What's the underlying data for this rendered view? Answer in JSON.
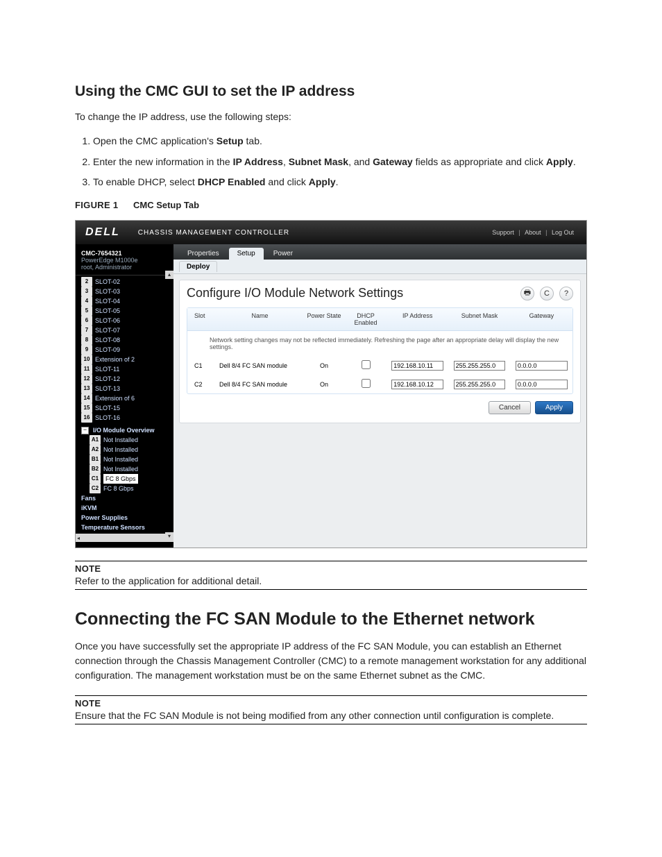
{
  "doc": {
    "h1": "Using the CMC GUI to set the IP address",
    "intro": "To change the IP address, use the following steps:",
    "steps": [
      {
        "pre": "Open the CMC application's ",
        "b": "Setup",
        "post": " tab."
      },
      {
        "pre": "Enter the new information in the ",
        "b": "IP Address",
        "mid": ", ",
        "b2": "Subnet Mask",
        "mid2": ", and ",
        "b3": "Gateway",
        "post": " fields as appropriate and click ",
        "b4": "Apply",
        "end": "."
      },
      {
        "pre": "To enable DHCP, select ",
        "b": "DHCP Enabled",
        "mid": " and click ",
        "b2": "Apply",
        "post": "."
      }
    ],
    "fig_label": "FIGURE 1",
    "fig_title": "CMC Setup Tab",
    "note1_word": "NOTE",
    "note1_text": "Refer to the application for additional detail.",
    "h2": "Connecting the FC SAN Module to the Ethernet network",
    "para2": "Once you have successfully set the appropriate IP address of the FC SAN Module, you can establish an Ethernet connection through the Chassis Management Controller (CMC) to a remote management workstation for any additional configuration. The management workstation must be on the same Ethernet subnet as the CMC.",
    "note2_word": "NOTE",
    "note2_text": "Ensure that the FC SAN Module is not being modified from any other connection until configuration is complete."
  },
  "cmc": {
    "logo": "DELL",
    "title": "CHASSIS MANAGEMENT CONTROLLER",
    "hdr_links": {
      "support": "Support",
      "about": "About",
      "logout": "Log Out"
    },
    "chassis": "CMC-7654321",
    "model": "PowerEdge M1000e",
    "user": "root, Administrator",
    "slots": [
      {
        "n": "2",
        "t": "SLOT-02"
      },
      {
        "n": "3",
        "t": "SLOT-03"
      },
      {
        "n": "4",
        "t": "SLOT-04"
      },
      {
        "n": "5",
        "t": "SLOT-05"
      },
      {
        "n": "6",
        "t": "SLOT-06"
      },
      {
        "n": "7",
        "t": "SLOT-07"
      },
      {
        "n": "8",
        "t": "SLOT-08"
      },
      {
        "n": "9",
        "t": "SLOT-09"
      },
      {
        "n": "10",
        "t": "Extension of 2"
      },
      {
        "n": "11",
        "t": "SLOT-11"
      },
      {
        "n": "12",
        "t": "SLOT-12"
      },
      {
        "n": "13",
        "t": "SLOT-13"
      },
      {
        "n": "14",
        "t": "Extension of 6"
      },
      {
        "n": "15",
        "t": "SLOT-15"
      },
      {
        "n": "16",
        "t": "SLOT-16"
      }
    ],
    "io_overview": "I/O Module Overview",
    "io_items": [
      {
        "n": "A1",
        "t": "Not Installed"
      },
      {
        "n": "A2",
        "t": "Not Installed"
      },
      {
        "n": "B1",
        "t": "Not Installed"
      },
      {
        "n": "B2",
        "t": "Not Installed"
      },
      {
        "n": "C1",
        "t": "FC 8 Gbps",
        "sel": true
      },
      {
        "n": "C2",
        "t": "FC 8 Gbps"
      }
    ],
    "extras": [
      "Fans",
      "iKVM",
      "Power Supplies",
      "Temperature Sensors"
    ],
    "tabs": {
      "properties": "Properties",
      "setup": "Setup",
      "power": "Power"
    },
    "subtab": "Deploy",
    "content_title": "Configure I/O Module Network Settings",
    "cols": {
      "slot": "Slot",
      "name": "Name",
      "pstate": "Power State",
      "dhcp": "DHCP Enabled",
      "ip": "IP Address",
      "mask": "Subnet Mask",
      "gw": "Gateway"
    },
    "note": "Network setting changes may not be reflected immediately. Refreshing the page after an appropriate delay will display the new settings.",
    "rows": [
      {
        "slot": "C1",
        "name": "Dell 8/4 FC SAN module",
        "pstate": "On",
        "dhcp": false,
        "ip": "192.168.10.11",
        "mask": "255.255.255.0",
        "gw": "0.0.0.0"
      },
      {
        "slot": "C2",
        "name": "Dell 8/4 FC SAN module",
        "pstate": "On",
        "dhcp": false,
        "ip": "192.168.10.12",
        "mask": "255.255.255.0",
        "gw": "0.0.0.0"
      }
    ],
    "buttons": {
      "cancel": "Cancel",
      "apply": "Apply"
    }
  }
}
